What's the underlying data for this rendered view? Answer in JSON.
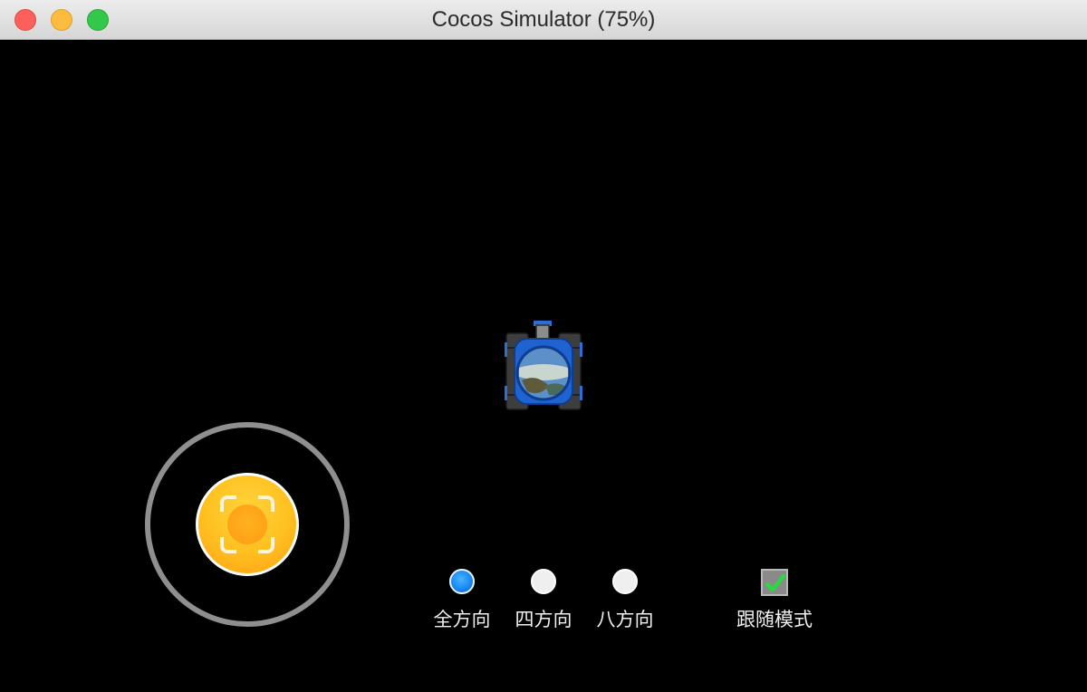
{
  "window": {
    "title": "Cocos Simulator (75%)"
  },
  "controls": {
    "direction_options": [
      {
        "label": "全方向",
        "selected": true
      },
      {
        "label": "四方向",
        "selected": false
      },
      {
        "label": "八方向",
        "selected": false
      }
    ],
    "follow_mode": {
      "label": "跟随模式",
      "checked": true
    }
  },
  "colors": {
    "background": "#000000",
    "joystick_knob": "#ffbf1f",
    "joystick_ring": "#8f8f8f",
    "radio_selected": "#1686f2",
    "checkmark": "#22e03a"
  }
}
